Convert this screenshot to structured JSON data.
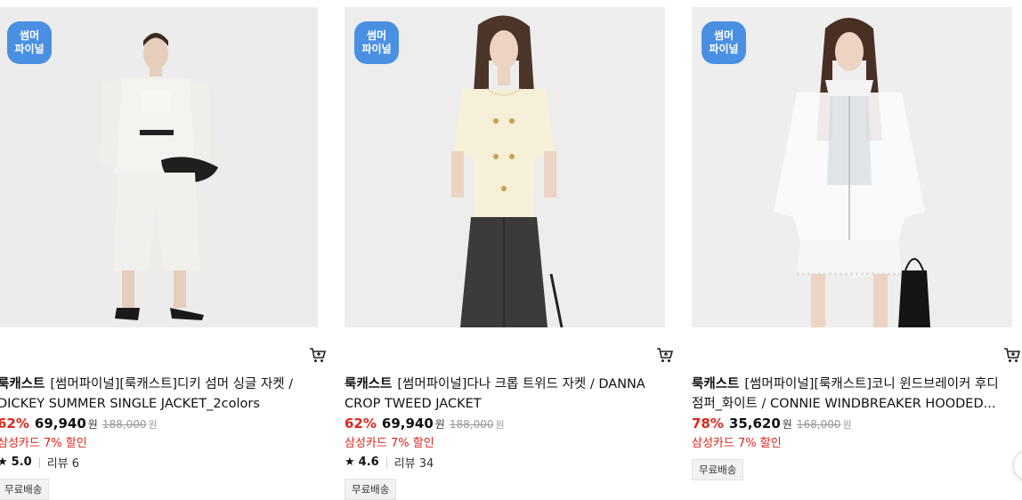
{
  "products": [
    {
      "badge": "썸머\n파이널",
      "brand": "룩캐스트",
      "title": "[썸머파이널][룩캐스트]디키 섬머 싱글 자켓 / DICKEY SUMMER SINGLE JACKET_2colors",
      "discount": "62%",
      "price": "69,940",
      "price_unit": "원",
      "original_price": "188,000",
      "original_unit": "원",
      "card_promo": "삼성카드 7% 할인",
      "rating": "5.0",
      "reviews": "리뷰 6",
      "shipping": "무료배송"
    },
    {
      "badge": "썸머\n파이널",
      "brand": "룩캐스트",
      "title": "[썸머파이널]다나 크롭 트위드 자켓 / DANNA CROP TWEED JACKET",
      "discount": "62%",
      "price": "69,940",
      "price_unit": "원",
      "original_price": "188,000",
      "original_unit": "원",
      "card_promo": "삼성카드 7% 할인",
      "rating": "4.6",
      "reviews": "리뷰 34",
      "shipping": "무료배송"
    },
    {
      "badge": "썸머\n파이널",
      "brand": "룩캐스트",
      "title": "[썸머파이널][룩캐스트]코니 윈드브레이커 후디 점퍼_화이트 / CONNIE WINDBREAKER HOODED...",
      "discount": "78%",
      "price": "35,620",
      "price_unit": "원",
      "original_price": "168,000",
      "original_unit": "원",
      "card_promo": "삼성카드 7% 할인",
      "shipping": "무료배송"
    }
  ],
  "colors": {
    "discount": "#e1251b",
    "badge": "#4a90e2",
    "thumb_bg": "#ebebeb"
  },
  "icons": {
    "cart": "cart-icon",
    "star": "star-icon"
  }
}
